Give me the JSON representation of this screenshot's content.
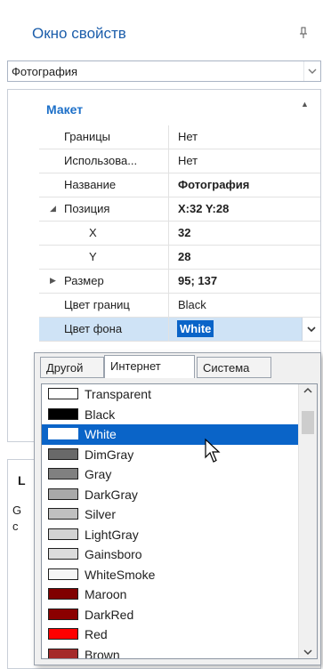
{
  "panel": {
    "title": "Окно свойств"
  },
  "object_selector": {
    "value": "Фотография"
  },
  "category": {
    "name": "Макет"
  },
  "properties": [
    {
      "name": "Границы",
      "value": "Нет"
    },
    {
      "name": "Использова...",
      "value": "Нет"
    },
    {
      "name": "Название",
      "value": "Фотография"
    },
    {
      "name": "Позиция",
      "value": "X:32 Y:28"
    },
    {
      "name": "X",
      "value": "32"
    },
    {
      "name": "Y",
      "value": "28"
    },
    {
      "name": "Размер",
      "value": "95; 137"
    },
    {
      "name": "Цвет границ",
      "value": "Black"
    },
    {
      "name": "Цвет фона",
      "value": "White"
    }
  ],
  "color_popup": {
    "tabs": [
      "Другой",
      "Интернет",
      "Система"
    ],
    "active_tab": "Интернет",
    "colors": [
      {
        "name": "Transparent",
        "hex": "#ffffff"
      },
      {
        "name": "Black",
        "hex": "#000000"
      },
      {
        "name": "White",
        "hex": "#ffffff"
      },
      {
        "name": "DimGray",
        "hex": "#696969"
      },
      {
        "name": "Gray",
        "hex": "#808080"
      },
      {
        "name": "DarkGray",
        "hex": "#a9a9a9"
      },
      {
        "name": "Silver",
        "hex": "#c0c0c0"
      },
      {
        "name": "LightGray",
        "hex": "#d3d3d3"
      },
      {
        "name": "Gainsboro",
        "hex": "#dcdcdc"
      },
      {
        "name": "WhiteSmoke",
        "hex": "#f5f5f5"
      },
      {
        "name": "Maroon",
        "hex": "#800000"
      },
      {
        "name": "DarkRed",
        "hex": "#8b0000"
      },
      {
        "name": "Red",
        "hex": "#ff0000"
      },
      {
        "name": "Brown",
        "hex": "#a52a2a"
      }
    ],
    "selected": "White"
  },
  "lower_panel": {
    "heading": "L",
    "line1": "G",
    "line2": "c"
  },
  "colors": {
    "accent": "#1c5eab",
    "selection": "#0a64c8"
  },
  "icons": [
    "pin-icon",
    "chevron-down-icon",
    "collapse-arrow-icon",
    "scroll-up-icon",
    "scroll-down-icon",
    "mouse-cursor-icon"
  ]
}
